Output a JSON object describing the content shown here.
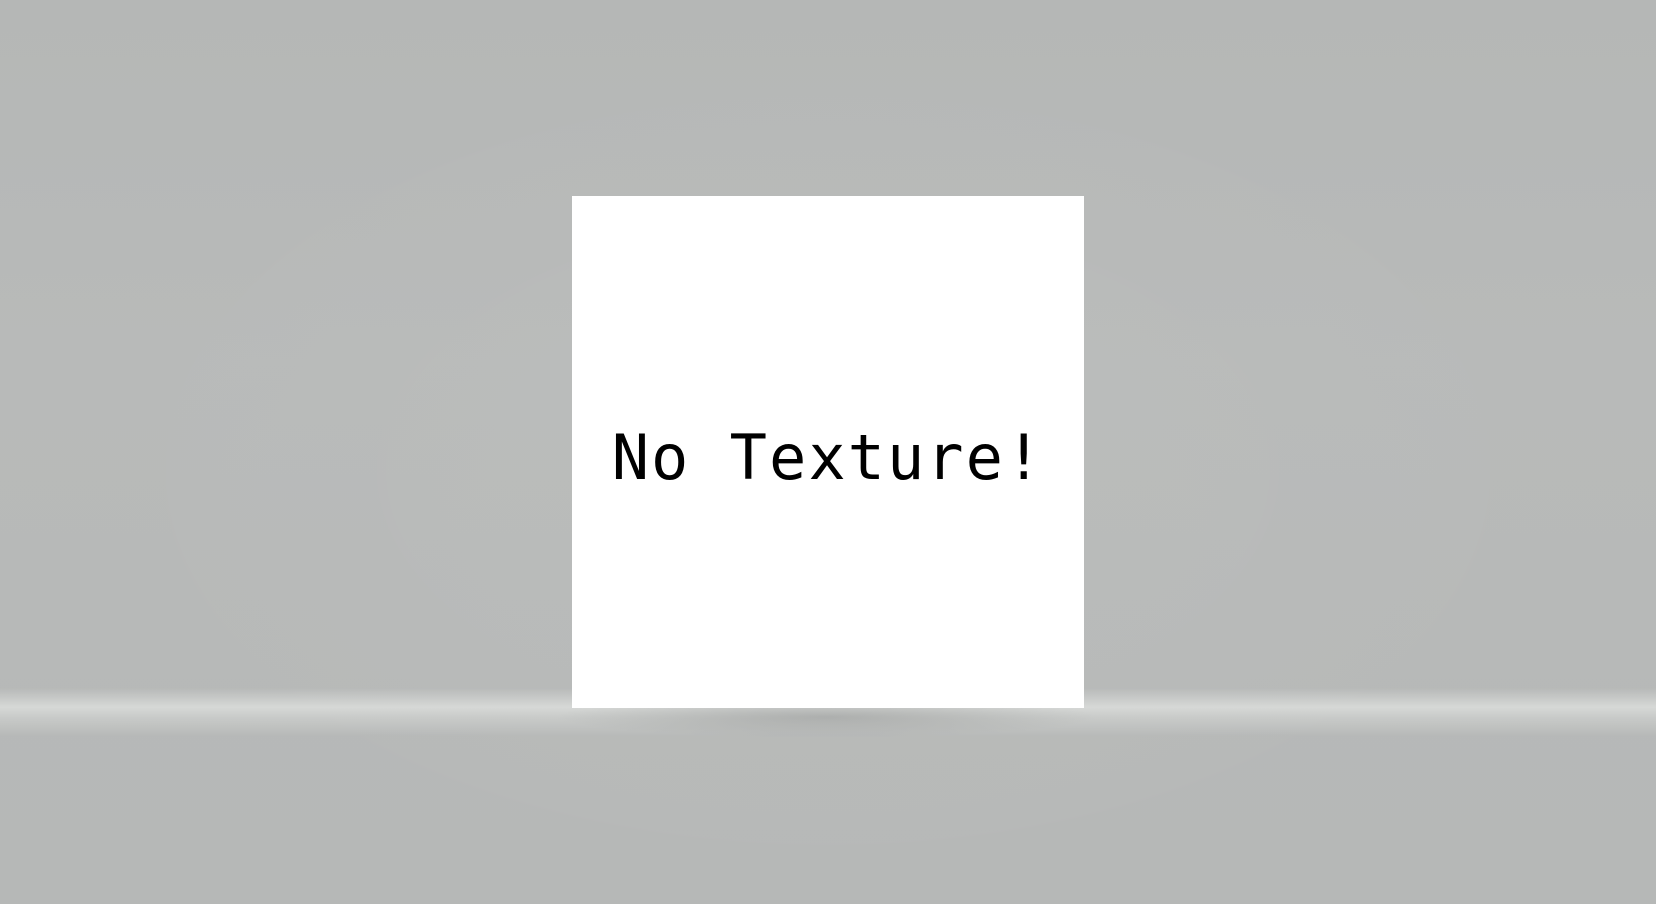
{
  "scene": {
    "background_color": "#b6b8b7",
    "floor_glow_color": "#d8dad8",
    "panel": {
      "label": "No Texture!",
      "background_color": "#ffffff",
      "text_color": "#000000"
    }
  }
}
